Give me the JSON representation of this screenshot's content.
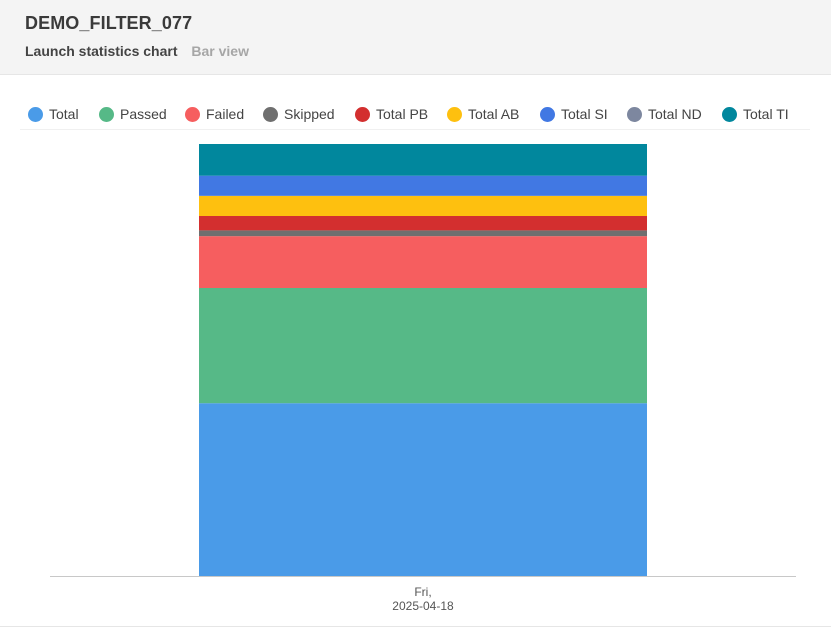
{
  "header": {
    "title": "DEMO_FILTER_077",
    "subtitle": "Launch statistics chart",
    "view_label": "Bar view"
  },
  "legend": [
    {
      "label": "Total",
      "color": "#4a9be8"
    },
    {
      "label": "Passed",
      "color": "#56b987"
    },
    {
      "label": "Failed",
      "color": "#f65e5f"
    },
    {
      "label": "Skipped",
      "color": "#6f6f6f"
    },
    {
      "label": "Total PB",
      "color": "#d32f2f"
    },
    {
      "label": "Total AB",
      "color": "#fec00f"
    },
    {
      "label": "Total SI",
      "color": "#4178e3"
    },
    {
      "label": "Total ND",
      "color": "#7d879f"
    },
    {
      "label": "Total TI",
      "color": "#01879d"
    }
  ],
  "chart_data": {
    "type": "bar",
    "stacked": true,
    "categories": [
      "Fri,\n2025-04-18"
    ],
    "category_lines": [
      [
        "Fri,",
        "2025-04-18"
      ]
    ],
    "series": [
      {
        "name": "Total",
        "values": [
          30
        ],
        "color": "#4a9be8"
      },
      {
        "name": "Passed",
        "values": [
          20
        ],
        "color": "#56b987"
      },
      {
        "name": "Failed",
        "values": [
          9
        ],
        "color": "#f65e5f"
      },
      {
        "name": "Skipped",
        "values": [
          1
        ],
        "color": "#6f6f6f"
      },
      {
        "name": "Total PB",
        "values": [
          2.5
        ],
        "color": "#d32f2f"
      },
      {
        "name": "Total AB",
        "values": [
          3.5
        ],
        "color": "#fec00f"
      },
      {
        "name": "Total SI",
        "values": [
          3.5
        ],
        "color": "#4178e3"
      },
      {
        "name": "Total ND",
        "values": [
          0
        ],
        "color": "#7d879f"
      },
      {
        "name": "Total TI",
        "values": [
          5.5
        ],
        "color": "#01879d"
      }
    ],
    "ylim": [
      0,
      75
    ],
    "grid": false,
    "legend_position": "top"
  }
}
